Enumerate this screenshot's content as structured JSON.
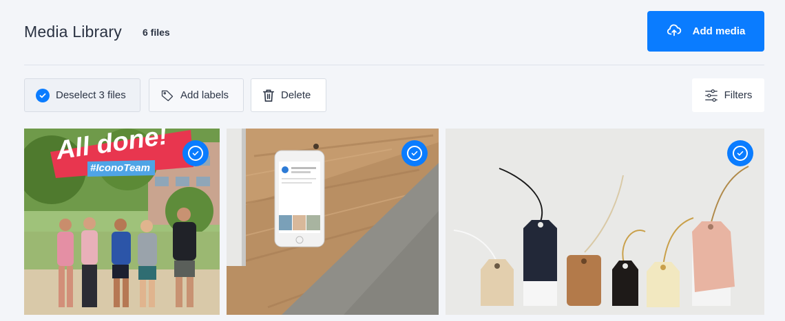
{
  "header": {
    "title": "Media Library",
    "file_count": "6 files",
    "add_media_label": "Add media"
  },
  "toolbar": {
    "deselect_label": "Deselect 3 files",
    "add_labels_label": "Add labels",
    "delete_label": "Delete",
    "filters_label": "Filters"
  },
  "media": [
    {
      "type": "photo",
      "subject": "group of people",
      "sticker_title": "All done!",
      "sticker_tag": "#IconoTeam",
      "selected": true
    },
    {
      "type": "photo",
      "subject": "smartphone on wooden desk",
      "selected": true
    },
    {
      "type": "photo",
      "subject": "paper gift tags",
      "selected": true
    }
  ],
  "colors": {
    "accent": "#0a7cff",
    "background": "#f3f5f9",
    "sticker_red": "#e8364f"
  },
  "icons": {
    "add_media": "cloud-upload-icon",
    "deselect": "check-circle-icon",
    "labels": "tag-icon",
    "delete": "trash-icon",
    "filters": "sliders-icon",
    "selected": "check-circle-icon"
  }
}
